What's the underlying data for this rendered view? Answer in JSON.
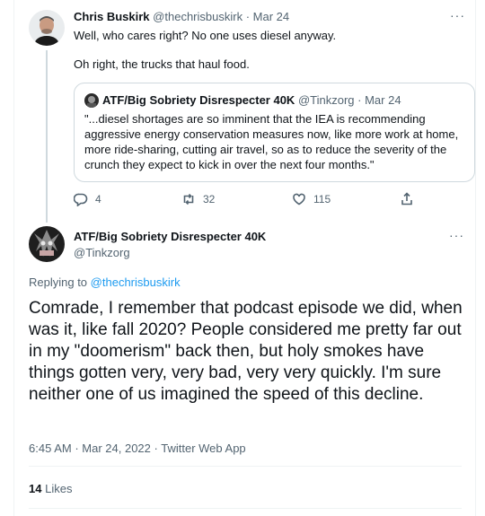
{
  "parent_tweet": {
    "author_name": "Chris Buskirk",
    "author_handle": "@thechrisbuskirk",
    "date": "Mar 24",
    "more_icon": "more-icon",
    "text_line1": "Well, who cares right? No one uses diesel anyway.",
    "text_line2": "Oh right, the trucks that haul food.",
    "quote": {
      "author_name": "ATF/Big Sobriety Disrespecter 40K",
      "author_handle": "@Tinkzorg",
      "date": "Mar 24",
      "text": "\"...diesel shortages are so imminent that the IEA is recommending aggressive energy conservation measures now, like more work at home, more ride-sharing, cutting air travel, so as to reduce the severity of the crunch they expect to kick in over the next four months.\""
    },
    "actions": {
      "reply_count": "4",
      "retweet_count": "32",
      "like_count": "115"
    }
  },
  "main_tweet": {
    "author_name": "ATF/Big Sobriety Disrespecter 40K",
    "author_handle": "@Tinkzorg",
    "replying_to_label": "Replying to",
    "replying_to_handle": "@thechrisbuskirk",
    "text": "Comrade, I remember that podcast episode we did, when was it, like fall 2020? People considered me pretty far out in my \"doomerism\" back then, but holy smokes have things gotten very, very bad, very very quickly. I'm sure neither one of us imagined the speed of this decline.",
    "time": "6:45 AM",
    "date": "Mar 24, 2022",
    "source": "Twitter Web App",
    "likes_count": "14",
    "likes_label": "Likes"
  },
  "colors": {
    "text": "#0f1419",
    "secondary": "#536471",
    "link": "#1d9bf0",
    "border": "#cfd9de"
  }
}
